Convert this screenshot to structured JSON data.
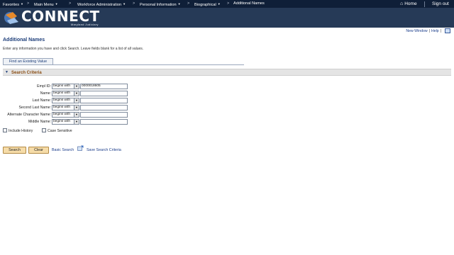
{
  "nav": {
    "favorites": "Favorites",
    "main_menu": "Main Menu",
    "workforce": "Workforce Administration",
    "personal": "Personal Information",
    "biographical": "Biographical",
    "current": "Additional Names",
    "separator": ">",
    "home": "Home",
    "sign_out": "Sign out"
  },
  "brand": {
    "name": "CONNECT",
    "sub": "Maryland Judiciary"
  },
  "util": {
    "new_window": "New Window",
    "help": "Help",
    "bar": "|"
  },
  "page": {
    "title": "Additional Names",
    "instructions": "Enter any information you have and click Search. Leave fields blank for a list of all values."
  },
  "tab": {
    "label": "Find an Existing Value"
  },
  "section": {
    "label": "Search Criteria"
  },
  "fields": [
    {
      "label": "Empl ID:",
      "operator": "begins with",
      "value": "0000018605"
    },
    {
      "label": "Name:",
      "operator": "begins with",
      "value": ""
    },
    {
      "label": "Last Name:",
      "operator": "begins with",
      "value": ""
    },
    {
      "label": "Second Last Name:",
      "operator": "begins with",
      "value": ""
    },
    {
      "label": "Alternate Character Name:",
      "operator": "begins with",
      "value": ""
    },
    {
      "label": "Middle Name:",
      "operator": "begins with",
      "value": ""
    }
  ],
  "options": {
    "include_history": "Include History",
    "case_sensitive": "Case Sensitive"
  },
  "actions": {
    "search": "Search",
    "clear": "Clear",
    "basic_search": "Basic Search",
    "save_criteria": "Save Search Criteria"
  },
  "icons": {
    "home": "home-icon",
    "dropdown": "chevron-down-icon",
    "save": "save-criteria-icon",
    "section": "collapse-triangle-icon"
  },
  "colors": {
    "topbar": "#0f1f38",
    "banner": "#263a57",
    "title": "#1d3e7a",
    "section_label": "#8a4e14",
    "button": "#f6dca8"
  }
}
